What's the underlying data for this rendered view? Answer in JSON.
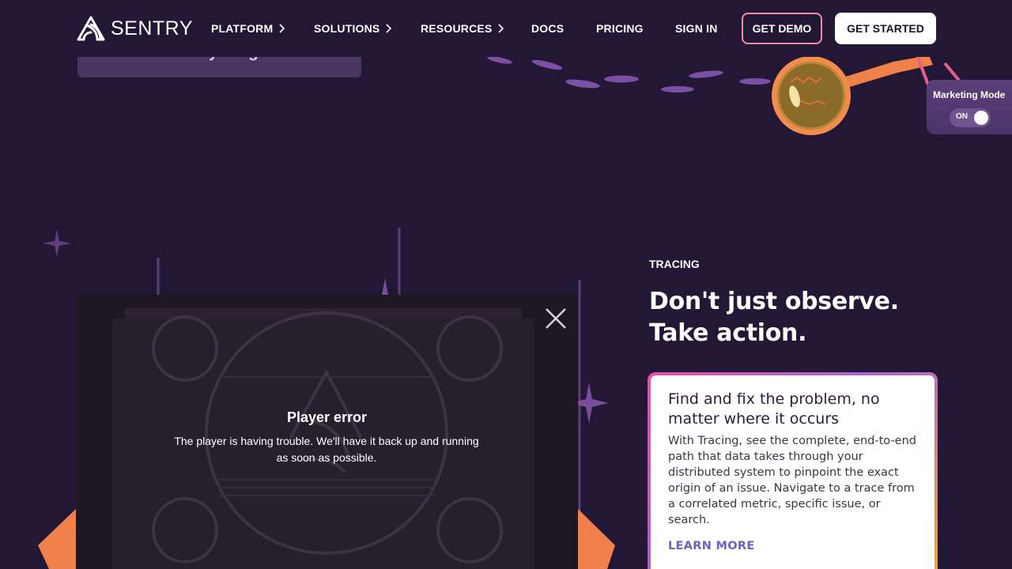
{
  "nav": {
    "logo_text": "SENTRY",
    "items": [
      {
        "label": "PLATFORM",
        "has_chevron": true
      },
      {
        "label": "SOLUTIONS",
        "has_chevron": true
      },
      {
        "label": "RESOURCES",
        "has_chevron": true
      },
      {
        "label": "DOCS",
        "has_chevron": false
      },
      {
        "label": "PRICING",
        "has_chevron": false
      },
      {
        "label": "SIGN IN",
        "has_chevron": false
      }
    ],
    "demo_button": "GET DEMO",
    "start_button": "GET STARTED"
  },
  "previous_card": {
    "label": "Automate everything"
  },
  "marketing_mode": {
    "label": "Marketing Mode",
    "state": "ON"
  },
  "section": {
    "eyebrow": "TRACING",
    "headline_line1": "Don't just observe.",
    "headline_line2": "Take action."
  },
  "feature_card": {
    "title": "Find and fix the problem, no matter where it occurs",
    "body": "With Tracing, see the complete, end-to-end path that data takes through your distributed system to pinpoint the exact origin of an issue. Navigate to a trace from a correlated metric, specific issue, or search.",
    "link": "LEARN MORE"
  },
  "player": {
    "error_title": "Player error",
    "error_message": "The player is having trouble. We'll have it back up and running as soon as possible."
  },
  "colors": {
    "background": "#221734",
    "demo_border": "#f48ea8",
    "link": "#6c5fc7",
    "card_gradient": [
      "#ec4fa2",
      "#a562d6",
      "#f2a33a"
    ],
    "orange_accent": "#f0804a"
  },
  "icons": [
    "sentry-logo-icon",
    "chevron-right-icon",
    "close-icon",
    "sparkle-icon",
    "orb-icon"
  ]
}
